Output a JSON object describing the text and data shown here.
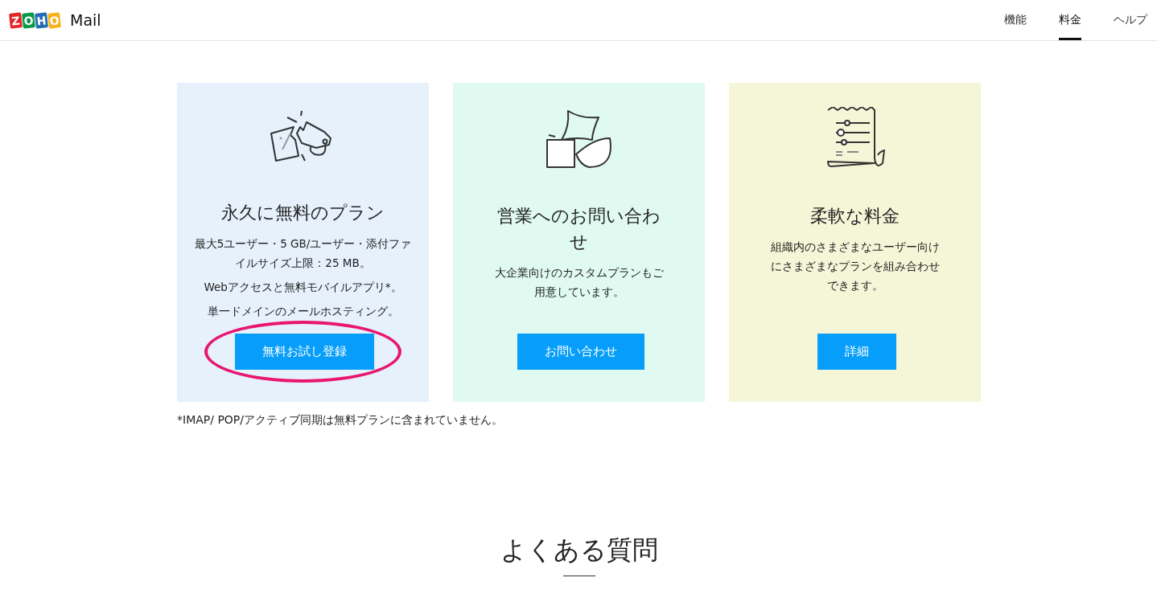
{
  "header": {
    "logo_letters": [
      {
        "letter": "Z",
        "color": "#e42527"
      },
      {
        "letter": "O",
        "color": "#089949"
      },
      {
        "letter": "H",
        "color": "#226db4"
      },
      {
        "letter": "O",
        "color": "#f9b21d"
      }
    ],
    "product": "Mail",
    "nav": [
      {
        "label": "機能",
        "selected": false
      },
      {
        "label": "料金",
        "selected": true
      },
      {
        "label": "ヘルプ",
        "selected": false
      }
    ]
  },
  "cards": [
    {
      "kind": "tags",
      "color": "#e6f1fc",
      "title": "永久に無料のプラン",
      "paragraphs": [
        "最大5ユーザー・5 GB/ユーザー・添付ファイルサイズ上限：25 MB。",
        "Webアクセスと無料モバイルアプリ*。",
        "単一ドメインのメールホスティング。"
      ],
      "button": {
        "label": "無料お試し登録",
        "highlighted": true
      }
    },
    {
      "kind": "shapes",
      "color": "#e0faf1",
      "title": "営業へのお問い合わせ",
      "paragraphs": [
        "大企業向けのカスタムプランもご用意しています。"
      ],
      "button": {
        "label": "お問い合わせ",
        "highlighted": false
      }
    },
    {
      "kind": "receipt",
      "color": "#f5f6d8",
      "title": "柔軟な料金",
      "paragraphs": [
        "組織内のさまざまなユーザー向けにさまざまなプランを組み合わせできます。"
      ],
      "button": {
        "label": "詳細",
        "highlighted": false
      }
    }
  ],
  "footnote": "*IMAP/ POP/アクティブ同期は無料プランに含まれていません。",
  "faq": {
    "title": "よくある質問"
  }
}
